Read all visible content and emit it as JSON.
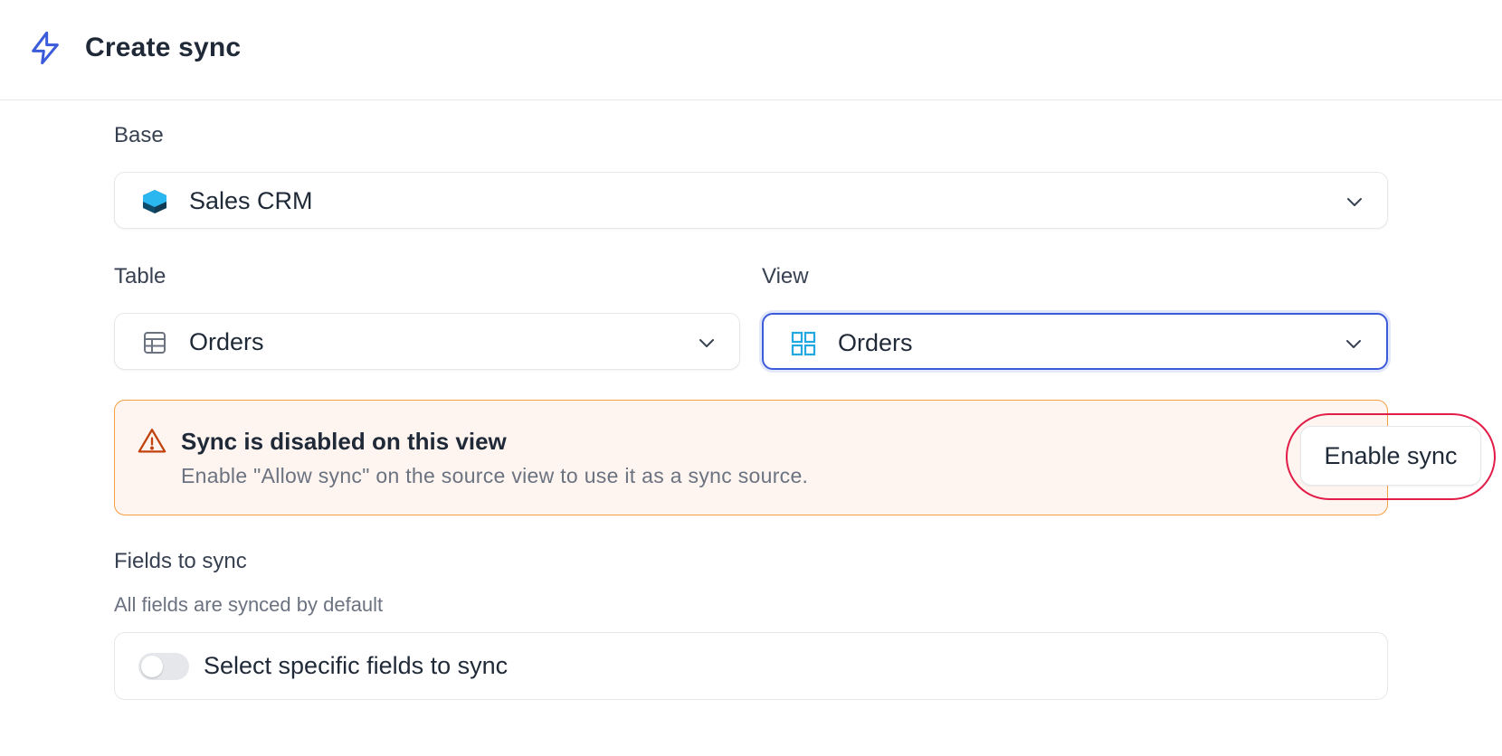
{
  "header": {
    "title": "Create sync",
    "icon": "bolt-icon"
  },
  "base": {
    "label": "Base",
    "value": "Sales CRM",
    "icon": "base-cube-icon"
  },
  "table": {
    "label": "Table",
    "value": "Orders",
    "icon": "grid-table-icon"
  },
  "view": {
    "label": "View",
    "value": "Orders",
    "icon": "gallery-view-icon"
  },
  "alert": {
    "title": "Sync is disabled on this view",
    "description": "Enable \"Allow sync\" on the source view to use it as a sync source.",
    "button_label": "Enable sync",
    "icon": "warning-triangle-icon"
  },
  "fields": {
    "label": "Fields to sync",
    "hint": "All fields are synced by default",
    "toggle_label": "Select specific fields to sync",
    "toggle_on": false
  },
  "colors": {
    "accent": "#3b5bdb",
    "warning_border": "#f59e42",
    "warning_bg": "#fef5f0",
    "highlight_ring": "#e11d48"
  }
}
